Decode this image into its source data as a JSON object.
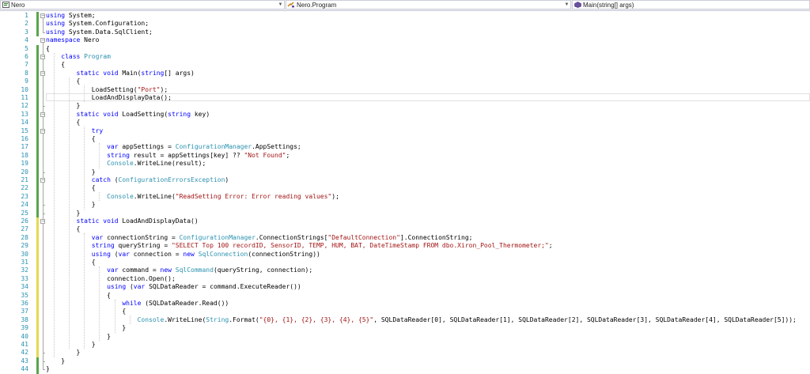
{
  "nav": {
    "project": "Nero",
    "type": "Nero.Program",
    "member": "Main(string[] args)"
  },
  "colors": {
    "added": "#57a64a",
    "modified": "#e7d84f",
    "keyword": "#0000ff",
    "type": "#2b91af",
    "string": "#a31515"
  },
  "code_lines": [
    {
      "n": "1",
      "c": "g",
      "t": [
        [
          "k",
          "using"
        ],
        [
          "",
          "System;"
        ]
      ]
    },
    {
      "n": "2",
      "c": "g",
      "t": [
        [
          "k",
          "using"
        ],
        [
          "",
          "System.Configuration;"
        ]
      ]
    },
    {
      "n": "3",
      "c": "g",
      "t": [
        [
          "k",
          "using"
        ],
        [
          "",
          "System.Data.SqlClient;"
        ]
      ]
    },
    {
      "n": "4",
      "c": "",
      "t": [
        [
          "k",
          "namespace"
        ],
        [
          "",
          "Nero"
        ]
      ]
    },
    {
      "n": "5",
      "c": "g",
      "t": [
        [
          "",
          "{"
        ]
      ]
    },
    {
      "n": "6",
      "c": "g",
      "t": [
        [
          "",
          "    "
        ],
        [
          "k",
          "class"
        ],
        [
          "t",
          " Program"
        ]
      ]
    },
    {
      "n": "7",
      "c": "g",
      "t": [
        [
          "",
          "    {"
        ]
      ]
    },
    {
      "n": "8",
      "c": "g",
      "t": [
        [
          "",
          "        "
        ],
        [
          "k",
          "static void"
        ],
        [
          "",
          " Main("
        ],
        [
          "k",
          "string"
        ],
        [
          "",
          "[] args)"
        ]
      ]
    },
    {
      "n": "9",
      "c": "g",
      "t": [
        [
          "",
          "        {"
        ]
      ]
    },
    {
      "n": "10",
      "c": "g",
      "t": [
        [
          "",
          "            LoadSetting("
        ],
        [
          "s",
          "\"Port\""
        ],
        [
          "",
          ");"
        ]
      ]
    },
    {
      "n": "11",
      "c": "g",
      "t": [
        [
          "",
          "            LoadAndDisplayData();"
        ]
      ]
    },
    {
      "n": "12",
      "c": "g",
      "t": [
        [
          "",
          "        }"
        ]
      ]
    },
    {
      "n": "13",
      "c": "g",
      "t": [
        [
          "",
          "        "
        ],
        [
          "k",
          "static void"
        ],
        [
          "",
          " LoadSetting("
        ],
        [
          "k",
          "string"
        ],
        [
          "",
          " key)"
        ]
      ]
    },
    {
      "n": "14",
      "c": "g",
      "t": [
        [
          "",
          "        {"
        ]
      ]
    },
    {
      "n": "15",
      "c": "g",
      "t": [
        [
          "",
          "            "
        ],
        [
          "k",
          "try"
        ]
      ]
    },
    {
      "n": "16",
      "c": "g",
      "t": [
        [
          "",
          "            {"
        ]
      ]
    },
    {
      "n": "17",
      "c": "g",
      "t": [
        [
          "",
          "                "
        ],
        [
          "k",
          "var"
        ],
        [
          "",
          " appSettings = "
        ],
        [
          "t",
          "ConfigurationManager"
        ],
        [
          "",
          ".AppSettings;"
        ]
      ]
    },
    {
      "n": "18",
      "c": "g",
      "t": [
        [
          "",
          "                "
        ],
        [
          "k",
          "string"
        ],
        [
          "",
          " result = appSettings[key] ?? "
        ],
        [
          "s",
          "\"Not Found\""
        ],
        [
          "",
          ";"
        ]
      ]
    },
    {
      "n": "19",
      "c": "g",
      "t": [
        [
          "",
          "                "
        ],
        [
          "t",
          "Console"
        ],
        [
          "",
          ".WriteLine(result);"
        ]
      ]
    },
    {
      "n": "20",
      "c": "g",
      "t": [
        [
          "",
          "            }"
        ]
      ]
    },
    {
      "n": "21",
      "c": "g",
      "t": [
        [
          "",
          "            "
        ],
        [
          "k",
          "catch"
        ],
        [
          "",
          " ("
        ],
        [
          "t",
          "ConfigurationErrorsException"
        ],
        [
          "",
          ")"
        ]
      ]
    },
    {
      "n": "22",
      "c": "g",
      "t": [
        [
          "",
          "            {"
        ]
      ]
    },
    {
      "n": "23",
      "c": "g",
      "t": [
        [
          "",
          "                "
        ],
        [
          "t",
          "Console"
        ],
        [
          "",
          ".WriteLine("
        ],
        [
          "s",
          "\"ReadSetting Error: Error reading values\""
        ],
        [
          "",
          ");"
        ]
      ]
    },
    {
      "n": "24",
      "c": "g",
      "t": [
        [
          "",
          "            }"
        ]
      ]
    },
    {
      "n": "25",
      "c": "g",
      "t": [
        [
          "",
          "        }"
        ]
      ]
    },
    {
      "n": "26",
      "c": "y",
      "t": [
        [
          "",
          "        "
        ],
        [
          "k",
          "static void"
        ],
        [
          "",
          " LoadAndDisplayData()"
        ]
      ]
    },
    {
      "n": "27",
      "c": "y",
      "t": [
        [
          "",
          "        {"
        ]
      ]
    },
    {
      "n": "28",
      "c": "y",
      "t": [
        [
          "",
          "            "
        ],
        [
          "k",
          "var"
        ],
        [
          "",
          " connectionString = "
        ],
        [
          "t",
          "ConfigurationManager"
        ],
        [
          "",
          ".ConnectionStrings["
        ],
        [
          "s",
          "\"DefaultConnection\""
        ],
        [
          "",
          "].ConnectionString;"
        ]
      ]
    },
    {
      "n": "29",
      "c": "y",
      "t": [
        [
          "",
          "            "
        ],
        [
          "k",
          "string"
        ],
        [
          "",
          " queryString = "
        ],
        [
          "s",
          "\"SELECT Top 100 recordID, SensorID, TEMP, HUM, BAT, DateTimeStamp FROM dbo.Xiron_Pool_Thermometer;\""
        ],
        [
          "",
          ";"
        ]
      ]
    },
    {
      "n": "30",
      "c": "y",
      "t": [
        [
          "",
          "            "
        ],
        [
          "k",
          "using"
        ],
        [
          "",
          " ("
        ],
        [
          "k",
          "var"
        ],
        [
          "",
          " connection = "
        ],
        [
          "k",
          "new"
        ],
        [
          "t",
          " SqlConnection"
        ],
        [
          "",
          "(connectionString))"
        ]
      ]
    },
    {
      "n": "31",
      "c": "y",
      "t": [
        [
          "",
          "            {"
        ]
      ]
    },
    {
      "n": "32",
      "c": "y",
      "t": [
        [
          "",
          "                "
        ],
        [
          "k",
          "var"
        ],
        [
          "",
          " command = "
        ],
        [
          "k",
          "new"
        ],
        [
          "t",
          " SqlCommand"
        ],
        [
          "",
          "(queryString, connection);"
        ]
      ]
    },
    {
      "n": "33",
      "c": "y",
      "t": [
        [
          "",
          "                connection.Open();"
        ]
      ]
    },
    {
      "n": "34",
      "c": "y",
      "t": [
        [
          "",
          "                "
        ],
        [
          "k",
          "using"
        ],
        [
          "",
          " ("
        ],
        [
          "k",
          "var"
        ],
        [
          "",
          " SQLDataReader = command.ExecuteReader())"
        ]
      ]
    },
    {
      "n": "35",
      "c": "y",
      "t": [
        [
          "",
          "                {"
        ]
      ]
    },
    {
      "n": "36",
      "c": "y",
      "t": [
        [
          "",
          "                    "
        ],
        [
          "k",
          "while"
        ],
        [
          "",
          " (SQLDataReader.Read())"
        ]
      ]
    },
    {
      "n": "37",
      "c": "y",
      "t": [
        [
          "",
          "                    {"
        ]
      ]
    },
    {
      "n": "38",
      "c": "y",
      "t": [
        [
          "",
          "                        "
        ],
        [
          "t",
          "Console"
        ],
        [
          "",
          ".WriteLine("
        ],
        [
          "t",
          "String"
        ],
        [
          "",
          ".Format("
        ],
        [
          "s",
          "\"{0}, {1}, {2}, {3}, {4}, {5}\""
        ],
        [
          "",
          ", SQLDataReader[0], SQLDataReader[1], SQLDataReader[2], SQLDataReader[3], SQLDataReader[4], SQLDataReader[5]));"
        ]
      ]
    },
    {
      "n": "39",
      "c": "y",
      "t": [
        [
          "",
          "                    }"
        ]
      ]
    },
    {
      "n": "40",
      "c": "y",
      "t": [
        [
          "",
          "                }"
        ]
      ]
    },
    {
      "n": "41",
      "c": "y",
      "t": [
        [
          "",
          "            }"
        ]
      ]
    },
    {
      "n": "42",
      "c": "y",
      "t": [
        [
          "",
          "        }"
        ]
      ]
    },
    {
      "n": "43",
      "c": "g",
      "t": [
        [
          "",
          "    }"
        ]
      ]
    },
    {
      "n": "44",
      "c": "g",
      "t": [
        [
          "",
          "}"
        ]
      ]
    }
  ]
}
